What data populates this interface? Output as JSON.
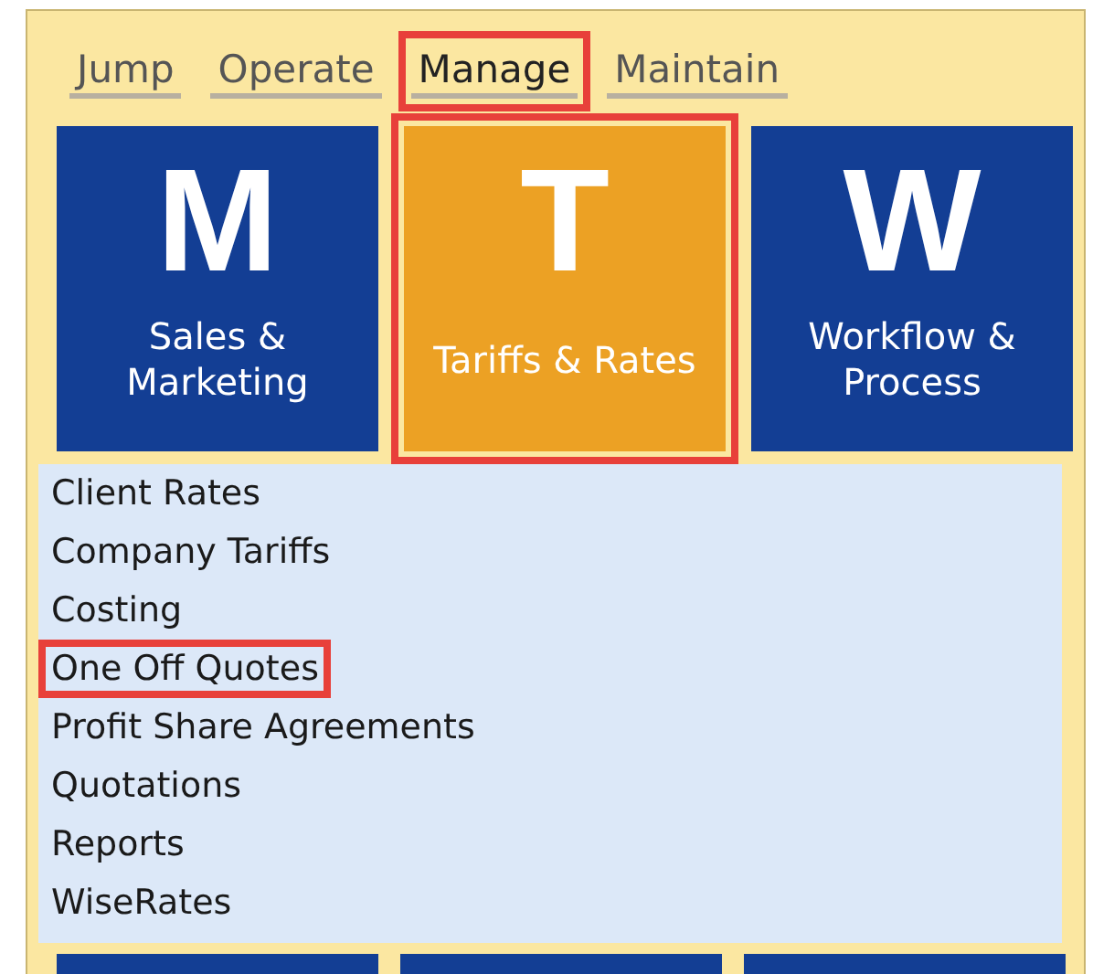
{
  "tabs": [
    {
      "label": "Jump",
      "selected": false,
      "highlighted": false
    },
    {
      "label": "Operate",
      "selected": false,
      "highlighted": false
    },
    {
      "label": "Manage",
      "selected": true,
      "highlighted": true
    },
    {
      "label": "Maintain",
      "selected": false,
      "highlighted": false
    }
  ],
  "tiles": [
    {
      "letter": "M",
      "label": "Sales & Marketing",
      "selected": false,
      "highlighted": false
    },
    {
      "letter": "T",
      "label": "Tariffs & Rates",
      "selected": true,
      "highlighted": true
    },
    {
      "letter": "W",
      "label": "Workflow & Process",
      "selected": false,
      "highlighted": false
    }
  ],
  "menu_items": [
    {
      "label": "Client Rates",
      "highlighted": false
    },
    {
      "label": "Company Tariffs",
      "highlighted": false
    },
    {
      "label": "Costing",
      "highlighted": false
    },
    {
      "label": "One Off Quotes",
      "highlighted": true
    },
    {
      "label": "Profit Share Agreements",
      "highlighted": false
    },
    {
      "label": "Quotations",
      "highlighted": false
    },
    {
      "label": "Reports",
      "highlighted": false
    },
    {
      "label": "WiseRates",
      "highlighted": false
    }
  ]
}
